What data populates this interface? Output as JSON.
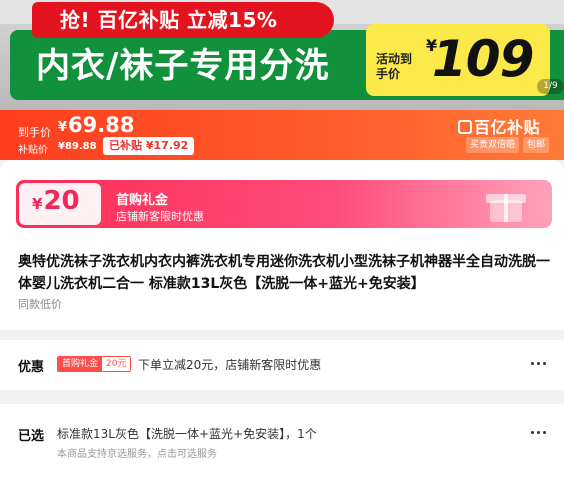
{
  "banner": {
    "promo": "抢! 百亿补贴 立减15%",
    "slogan": "内衣/袜子专用分洗",
    "price_label": "活动到手价",
    "price_symbol": "¥",
    "price": "109",
    "page_indicator": "1/9"
  },
  "price_strip": {
    "final_label": "到手价",
    "final_symbol": "¥",
    "final_price": "69.88",
    "subsidy_label": "补贴价",
    "subsidy_price": "¥89.88",
    "saved": "已补贴 ¥17.92",
    "brand": "百亿补贴",
    "tags": [
      "买贵双倍赔",
      "包邮"
    ]
  },
  "coupon": {
    "symbol": "¥",
    "amount": "20",
    "title": "首购礼金",
    "desc": "店铺新客限时优惠"
  },
  "product": {
    "title": "奥特优洗袜子洗衣机内衣内裤洗衣机专用迷你洗衣机小型洗袜子机神器半全自动洗脱一体婴儿洗衣机二合一 标准款13L灰色【洗脱一体+蓝光+免安装】",
    "subtitle": "同款低价"
  },
  "discount_row": {
    "label": "优惠",
    "badge_left": "首购礼金",
    "badge_right": "20元",
    "text": "下单立减20元，店铺新客限时优惠"
  },
  "selection_row": {
    "label": "已选",
    "text": "标准款13L灰色【洗脱一体+蓝光+免安装】，1个",
    "sub": "本商品支持京选服务，点击可选服务"
  },
  "colors": {
    "accent_red": "#ff3d1f",
    "banner_green": "#11913c",
    "price_yellow": "#fbe94a",
    "coupon_pink": "#ff2c55"
  }
}
